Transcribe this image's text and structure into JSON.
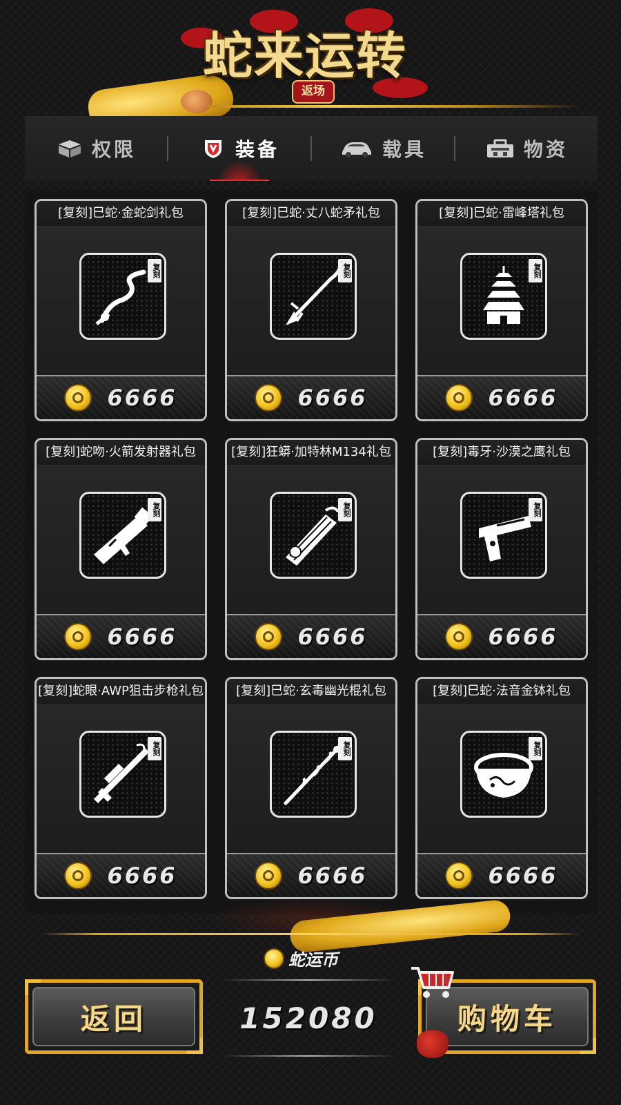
{
  "header": {
    "title": "蛇来运转",
    "badge": "返场"
  },
  "tabs": [
    {
      "label": "权限",
      "icon": "box-icon",
      "active": false
    },
    {
      "label": "装备",
      "icon": "shield-icon",
      "active": true
    },
    {
      "label": "载具",
      "icon": "car-icon",
      "active": false
    },
    {
      "label": "物资",
      "icon": "toolbox-icon",
      "active": false
    }
  ],
  "items": [
    {
      "title": "[复刻]巳蛇·金蛇剑礼包",
      "tag": "复刻",
      "price": "6666",
      "icon": "snake-sword-icon"
    },
    {
      "title": "[复刻]巳蛇·丈八蛇矛礼包",
      "tag": "复刻",
      "price": "6666",
      "icon": "snake-spear-icon"
    },
    {
      "title": "[复刻]巳蛇·雷峰塔礼包",
      "tag": "复刻",
      "price": "6666",
      "icon": "pagoda-icon"
    },
    {
      "title": "[复刻]蛇吻·火箭发射器礼包",
      "tag": "复刻",
      "price": "6666",
      "icon": "rocket-launcher-icon"
    },
    {
      "title": "[复刻]狂蟒·加特林M134礼包",
      "tag": "复刻",
      "price": "6666",
      "icon": "gatling-icon"
    },
    {
      "title": "[复刻]毒牙·沙漠之鹰礼包",
      "tag": "复刻",
      "price": "6666",
      "icon": "pistol-icon"
    },
    {
      "title": "[复刻]蛇眼·AWP狙击步枪礼包",
      "tag": "复刻",
      "price": "6666",
      "icon": "sniper-rifle-icon"
    },
    {
      "title": "[复刻]巳蛇·玄毒幽光棍礼包",
      "tag": "复刻",
      "price": "6666",
      "icon": "staff-icon"
    },
    {
      "title": "[复刻]巳蛇·法音金钵礼包",
      "tag": "复刻",
      "price": "6666",
      "icon": "golden-bowl-icon"
    }
  ],
  "footer": {
    "back_label": "返回",
    "currency_label": "蛇运币",
    "currency_value": "152080",
    "cart_label": "购物车"
  },
  "colors": {
    "accent_gold": "#e2a626",
    "active_tab_red": "#e33333",
    "coin_gold": "#f3c31c"
  }
}
